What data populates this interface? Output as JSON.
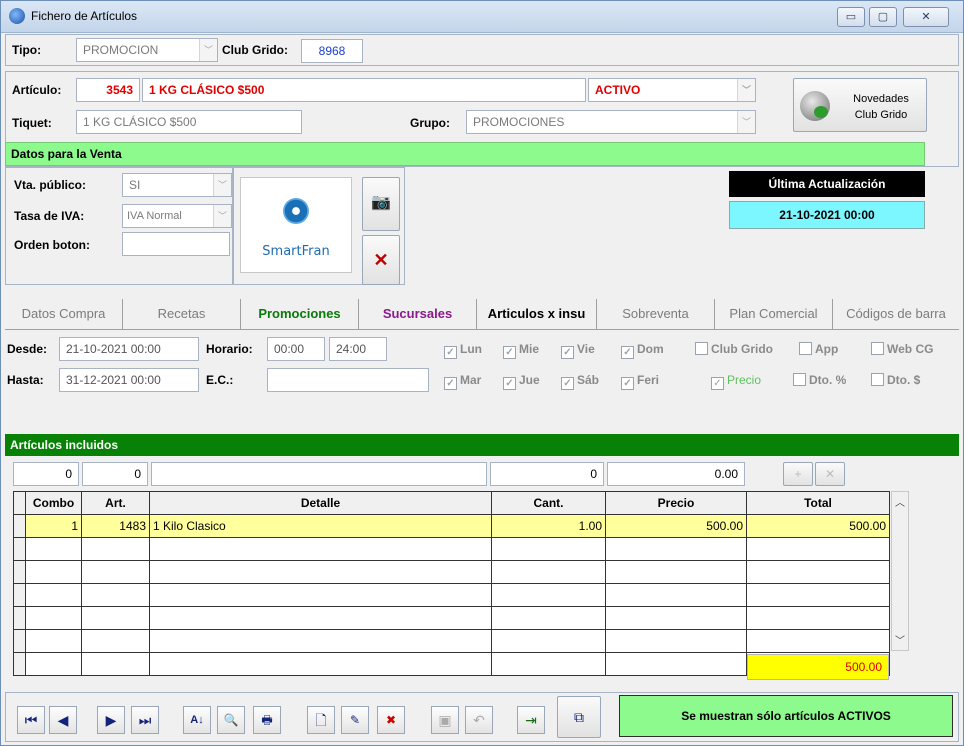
{
  "window": {
    "title": "Fichero de Artículos",
    "controls": [
      "▭",
      "▢",
      "✕"
    ]
  },
  "header": {
    "tipo_label": "Tipo:",
    "tipo_value": "PROMOCION",
    "club_label": "Club Grido:",
    "club_value": "8968"
  },
  "articulo": {
    "label": "Artículo:",
    "code": "3543",
    "name": "1 KG CLÁSICO $500",
    "status": "ACTIVO",
    "tiquet_label": "Tiquet:",
    "tiquet_value": "1 KG CLÁSICO $500",
    "grupo_label": "Grupo:",
    "grupo_value": "PROMOCIONES",
    "novedades_label": "Novedades\nClub Grido"
  },
  "venta": {
    "section_title": "Datos para la Venta",
    "vta_label": "Vta. público:",
    "vta_value": "SI",
    "iva_label": "Tasa de IVA:",
    "iva_value": "IVA Normal",
    "orden_label": "Orden boton:",
    "orden_value": "",
    "logo_text": "SmartFran",
    "ultima_label": "Última Actualización",
    "ultima_value": "21-10-2021 00:00"
  },
  "tabs": [
    {
      "label": "Datos Compra"
    },
    {
      "label": "Recetas"
    },
    {
      "label": "Promociones"
    },
    {
      "label": "Sucursales"
    },
    {
      "label": "Articulos x insu"
    },
    {
      "label": "Sobreventa"
    },
    {
      "label": "Plan Comercial"
    },
    {
      "label": "Códigos de barra"
    }
  ],
  "promo": {
    "desde_label": "Desde:",
    "desde_value": "21-10-2021 00:00",
    "hasta_label": "Hasta:",
    "hasta_value": "31-12-2021 00:00",
    "horario_label": "Horario:",
    "horario_from": "00:00",
    "horario_to": "24:00",
    "ec_label": "E.C.:",
    "ec_value": "",
    "days_row1": [
      "Lun",
      "Mie",
      "Vie",
      "Dom"
    ],
    "days_row2": [
      "Mar",
      "Jue",
      "Sáb",
      "Feri"
    ],
    "opts_row1": [
      "Club Grido",
      "App",
      "Web CG"
    ],
    "precio_label": "Precio",
    "opts_row2": [
      "Dto. %",
      "Dto. $"
    ]
  },
  "incluidos": {
    "section_title": "Artículos incluidos",
    "entry": {
      "combo": "0",
      "art": "0",
      "detalle": "",
      "cant": "0",
      "precio": "0.00"
    },
    "columns": [
      "Combo",
      "Art.",
      "Detalle",
      "Cant.",
      "Precio",
      "Total"
    ],
    "rows": [
      {
        "combo": "1",
        "art": "1483",
        "detalle": "1 Kilo Clasico",
        "cant": "1.00",
        "precio": "500.00",
        "total": "500.00"
      }
    ],
    "grand_total": "500.00"
  },
  "footer": {
    "status_button": "Se muestran sólo artículos ACTIVOS"
  }
}
